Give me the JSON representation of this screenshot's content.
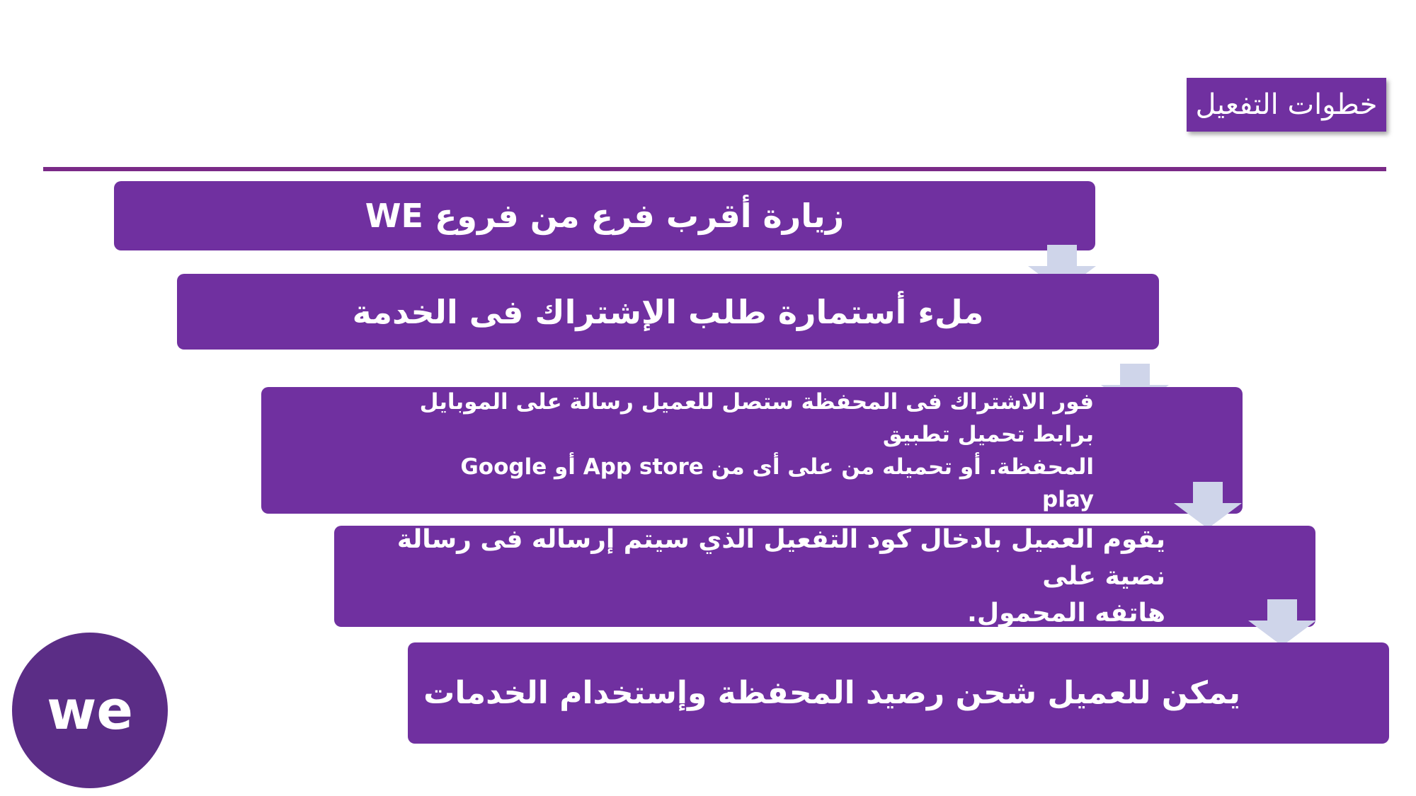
{
  "title": "خطوات التفعيل",
  "steps": [
    {
      "text": "زيارة أقرب فرع من فروع WE"
    },
    {
      "text": "ملء أستمارة طلب الإشتراك فى الخدمة"
    },
    {
      "line1": "فور الاشتراك فى المحفظة ستصل للعميل رسالة على الموبايل برابط تحميل تطبيق",
      "line2": "المحفظة. أو تحميله من على أى من App store أو Google play"
    },
    {
      "line1": "يقوم العميل بادخال كود التفعيل الذي سيتم إرساله فى رسالة نصية على",
      "line2": "هاتفه المحمول."
    },
    {
      "text": "يمكن للعميل شحن رصيد المحفظة وإستخدام الخدمات"
    }
  ],
  "logo": {
    "icon": "we-logo",
    "text": "we"
  },
  "colors": {
    "box": "#7030a0",
    "arrow": "#cfd5ea",
    "divider": "#7a2a87",
    "logo": "#5b2d86"
  }
}
